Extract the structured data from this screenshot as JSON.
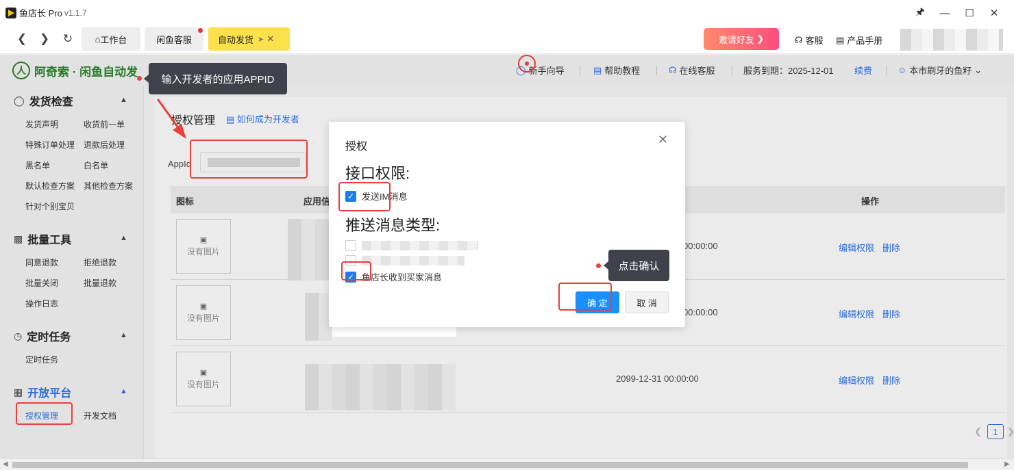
{
  "window": {
    "app_name": "鱼店长 Pro",
    "version": "v1.1.7"
  },
  "tabs": {
    "home": "工作台",
    "customer_service": "闲鱼客服",
    "auto_ship": "自动发货"
  },
  "topbar": {
    "invite": "邀请好友",
    "service": "客服",
    "manual": "产品手册"
  },
  "header": {
    "brand": "阿奇索 · 闲鱼自动发",
    "guide": "新手向导",
    "help": "帮助教程",
    "online_service": "在线客服",
    "expiry": "服务到期：2025-12-01",
    "renew": "续费",
    "user": "本市刷牙的鱼籽"
  },
  "sidebar": {
    "sections": [
      {
        "title": "发货检查",
        "items": [
          "发货声明",
          "收货前一单",
          "特殊订单处理",
          "退款后处理",
          "黑名单",
          "白名单",
          "默认检查方案",
          "其他检查方案",
          "针对个别宝贝"
        ]
      },
      {
        "title": "批量工具",
        "items": [
          "同意退款",
          "拒绝退款",
          "批量关闭",
          "批量退款",
          "操作日志"
        ]
      },
      {
        "title": "定时任务",
        "items": [
          "定时任务"
        ]
      },
      {
        "title": "开放平台",
        "items": [
          "授权管理",
          "开发文档"
        ]
      }
    ]
  },
  "main": {
    "title": "授权管理",
    "how_link": "如何成为开发者",
    "appid_label": "AppId",
    "columns": [
      "图标",
      "应用信",
      "操作"
    ],
    "no_image": "没有图片",
    "rows": [
      {
        "time": "00:00:00",
        "edit": "编辑权限",
        "delete": "删除"
      },
      {
        "time": "00:00:00",
        "edit": "编辑权限",
        "delete": "删除"
      },
      {
        "time": "2099-12-31 00:00:00",
        "edit": "编辑权限",
        "delete": "删除"
      }
    ],
    "page": "1"
  },
  "modal": {
    "title": "授权",
    "api_section": "接口权限:",
    "api_option": "发送IM消息",
    "push_section": "推送消息类型:",
    "push_option_3": "鱼店长收到买家消息",
    "ok": "确 定",
    "cancel": "取 消"
  },
  "annotations": {
    "appid_tip": "输入开发者的应用APPID",
    "ok_tip": "点击确认"
  },
  "colors": {
    "accent": "#1890ff",
    "brand_green": "#2a7a2a",
    "tab_active": "#fbe14b",
    "annotation_red": "#e8403a"
  }
}
